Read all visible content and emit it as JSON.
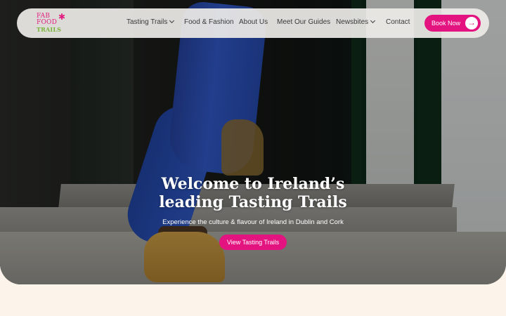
{
  "logo": {
    "line1": "FAB",
    "line2": "FOOD",
    "line3": "TRAILS",
    "flower_icon": "asterisk-flower-icon"
  },
  "nav": {
    "items": [
      {
        "label": "Tasting Trails",
        "has_dropdown": true
      },
      {
        "label": "Food & Fashion",
        "has_dropdown": false
      },
      {
        "label": "About Us",
        "has_dropdown": false
      },
      {
        "label": "Meet Our Guides",
        "has_dropdown": false
      },
      {
        "label": "Newsbites",
        "has_dropdown": true
      },
      {
        "label": "Contact",
        "has_dropdown": false
      }
    ],
    "book_label": "Book Now",
    "book_icon": "arrow-right-icon"
  },
  "hero": {
    "headline_line1": "Welcome to Ireland’s",
    "headline_line2": "leading Tasting Trails",
    "subtitle": "Experience the culture & flavour of Ireland in Dublin and Cork",
    "cta_label": "View Tasting Trails"
  },
  "colors": {
    "accent": "#e3137f",
    "logo_green": "#7ab33b",
    "page_bg": "#fcf4ea",
    "navbar_bg": "#eeece8"
  }
}
